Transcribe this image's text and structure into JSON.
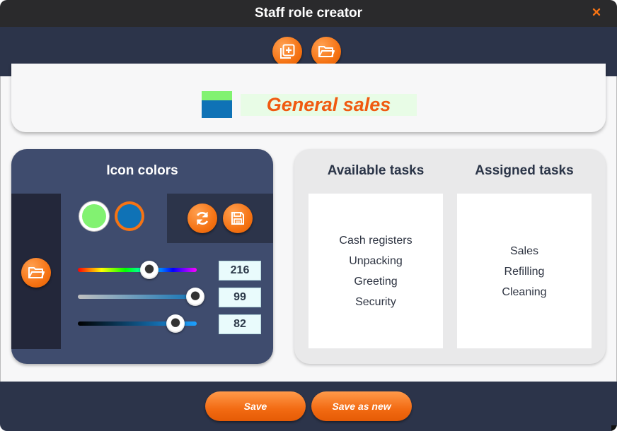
{
  "window": {
    "title": "Staff role creator"
  },
  "toolbar": {
    "buttons": [
      {
        "icon": "new-icon"
      },
      {
        "icon": "open-folder-icon"
      }
    ]
  },
  "role": {
    "name": "General sales",
    "icon_colors": {
      "top": "#82f271",
      "bottom": "#0f72b6"
    }
  },
  "icon_colors_panel": {
    "title": "Icon colors",
    "swatches": [
      {
        "color": "#82f271",
        "selected": true
      },
      {
        "color": "#0f72b6",
        "selected": false
      }
    ],
    "actions": [
      {
        "icon": "refresh-icon"
      },
      {
        "icon": "save-icon"
      }
    ],
    "side_button": {
      "icon": "open-folder-icon"
    },
    "sliders": [
      {
        "name": "hue",
        "value": "216",
        "min": 0,
        "max": 360
      },
      {
        "name": "saturation",
        "value": "99",
        "min": 0,
        "max": 100
      },
      {
        "name": "brightness",
        "value": "82",
        "min": 0,
        "max": 100
      }
    ]
  },
  "tasks": {
    "available": {
      "title": "Available tasks",
      "items": [
        "Cash registers",
        "Unpacking",
        "Greeting",
        "Security"
      ]
    },
    "assigned": {
      "title": "Assigned tasks",
      "items": [
        "Sales",
        "Refilling",
        "Cleaning"
      ]
    }
  },
  "footer": {
    "save_label": "Save",
    "save_as_new_label": "Save as new"
  },
  "colors": {
    "accent": "#f57314",
    "dark_navy": "#2c344a",
    "panel_blue": "#3f4c6e",
    "role_text": "#f05a10"
  }
}
